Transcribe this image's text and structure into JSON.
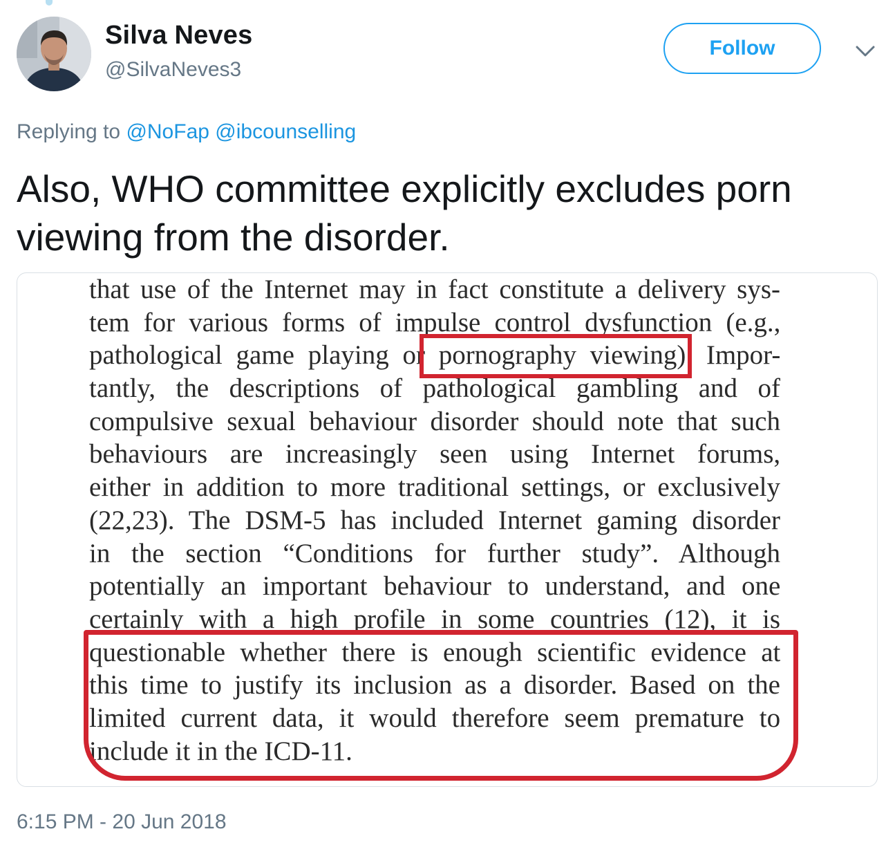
{
  "user": {
    "name": "Silva Neves",
    "handle": "@SilvaNeves3"
  },
  "header": {
    "follow_label": "Follow"
  },
  "reply": {
    "prefix": "Replying to ",
    "mentions": [
      "@NoFap",
      "@ibcounselling"
    ]
  },
  "tweet": {
    "text": "Also, WHO committee explicitly excludes porn viewing from the disorder."
  },
  "media": {
    "lines": [
      "that use of the Internet may in fact constitute a delivery sys-",
      "tem for various forms of impulse control dysfunction (e.g.,",
      "pathological game playing or pornography viewing). Impor-",
      "tantly, the descriptions of pathological gambling and of",
      "compulsive sexual behaviour disorder should note that such",
      "behaviours are increasingly seen using Internet forums,",
      "either in addition to more traditional settings, or exclusively",
      "(22,23). The DSM-5 has included Internet gaming disorder",
      "in the section “Conditions for further study”. Although",
      "potentially an important behaviour to understand, and one",
      "certainly with a high profile in some countries (12), it is",
      "questionable whether there is enough scientific evidence at",
      "this time to justify its inclusion as a disorder. Based on the",
      "limited current data, it would therefore seem premature to",
      "include it in the ICD-11."
    ],
    "highlight_color": "#d1242f"
  },
  "timestamp": "6:15 PM - 20 Jun 2018",
  "colors": {
    "accent": "#1da1f2",
    "mention": "#1b95e0",
    "secondary_text": "#657786",
    "primary_text": "#14171a"
  },
  "icons": {
    "menu": "chevron-down-icon",
    "avatar": "avatar"
  }
}
